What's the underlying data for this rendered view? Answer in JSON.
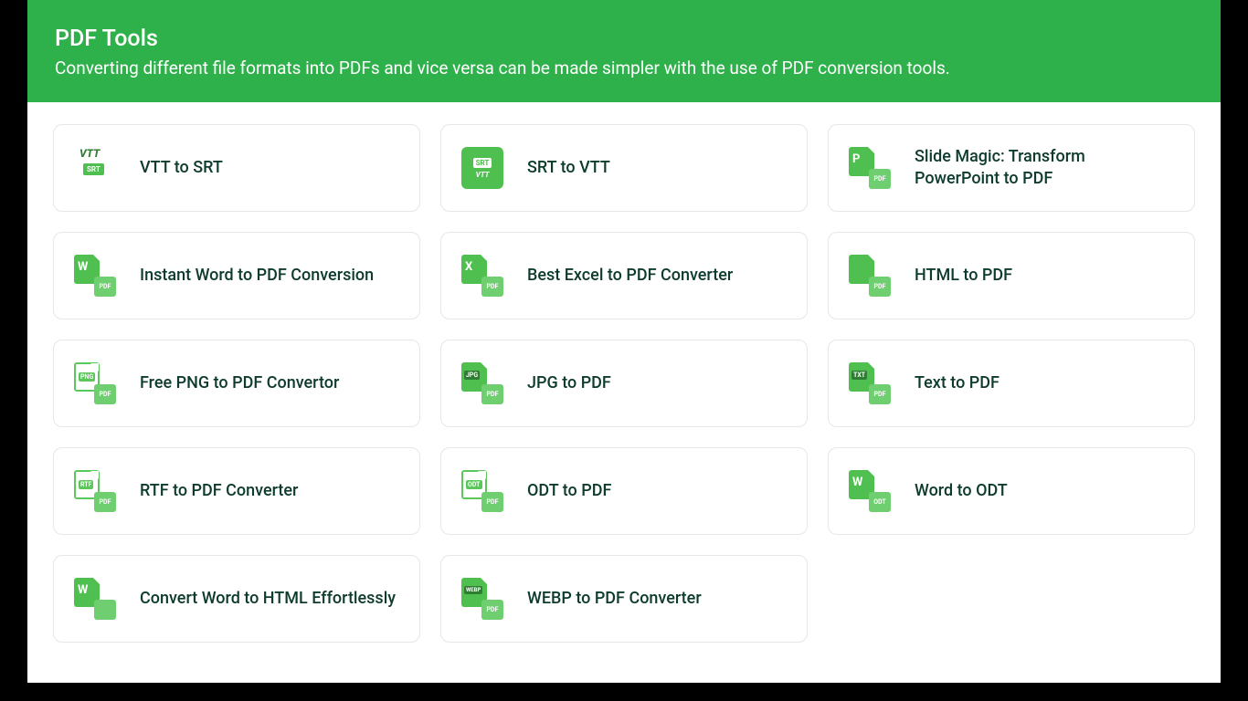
{
  "header": {
    "title": "PDF Tools",
    "subtitle": "Converting different file formats into PDFs and vice versa can be made simpler with the use of PDF conversion tools."
  },
  "tools": [
    {
      "label": "VTT to SRT",
      "icon": "vtt-to-srt"
    },
    {
      "label": "SRT to VTT",
      "icon": "srt-to-vtt"
    },
    {
      "label": "Slide Magic: Transform PowerPoint to PDF",
      "icon": "ppt-to-pdf"
    },
    {
      "label": "Instant Word to PDF Conversion",
      "icon": "word-to-pdf"
    },
    {
      "label": "Best Excel to PDF Converter",
      "icon": "excel-to-pdf"
    },
    {
      "label": "HTML to PDF",
      "icon": "html-to-pdf"
    },
    {
      "label": "Free PNG to PDF Convertor",
      "icon": "png-to-pdf"
    },
    {
      "label": "JPG to PDF",
      "icon": "jpg-to-pdf"
    },
    {
      "label": "Text to PDF",
      "icon": "txt-to-pdf"
    },
    {
      "label": "RTF to PDF Converter",
      "icon": "rtf-to-pdf"
    },
    {
      "label": "ODT to PDF",
      "icon": "odt-to-pdf"
    },
    {
      "label": "Word to ODT",
      "icon": "word-to-odt"
    },
    {
      "label": "Convert Word to HTML Effortlessly",
      "icon": "word-to-html"
    },
    {
      "label": "WEBP to PDF Converter",
      "icon": "webp-to-pdf"
    }
  ]
}
